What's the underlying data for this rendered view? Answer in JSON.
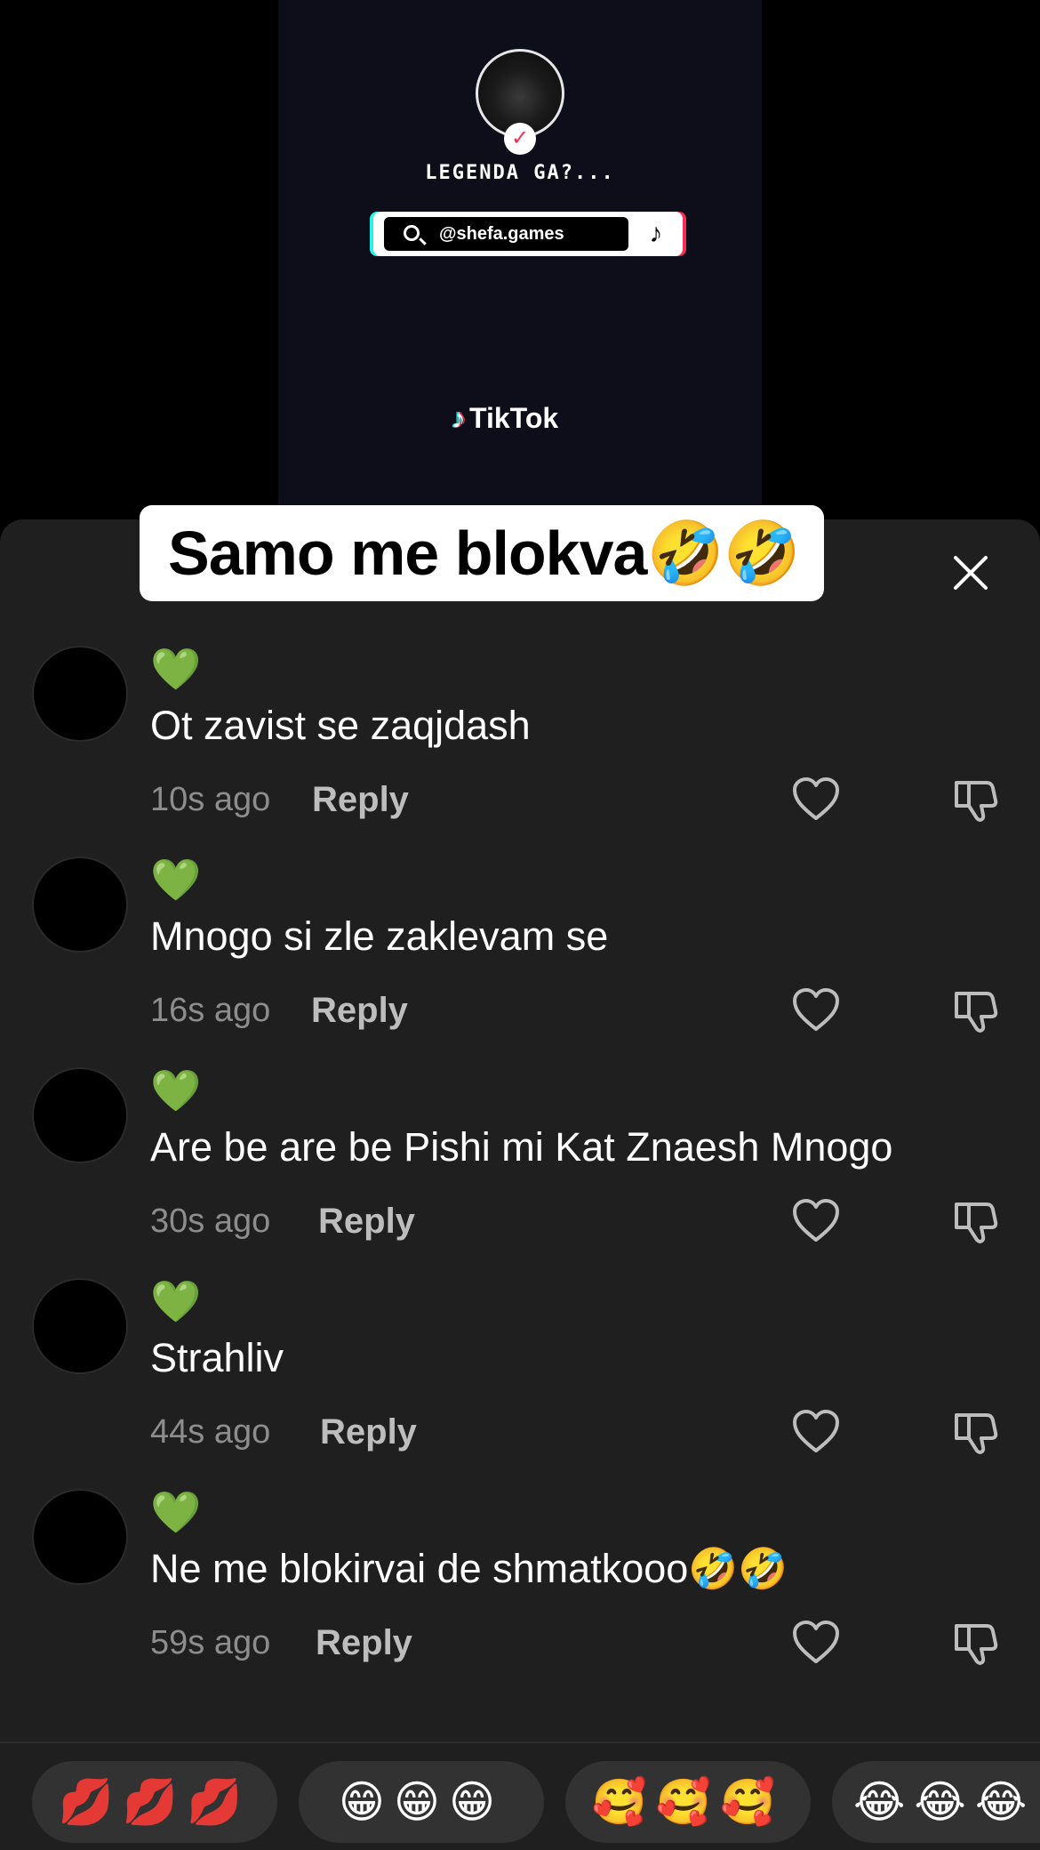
{
  "video": {
    "profile_name": "LEGENDA GA?...",
    "verified_mark": "✓",
    "search_handle": "@shefa.games",
    "tiktok_note": "♪",
    "brand": "TikTok"
  },
  "caption": "Samo me blokva🤣🤣",
  "comments": [
    {
      "heart": "💚",
      "text": "Ot zavist se zaqjdash",
      "time": "10s ago",
      "reply": "Reply"
    },
    {
      "heart": "💚",
      "text": "Mnogo si zle zaklevam se",
      "time": "16s ago",
      "reply": "Reply"
    },
    {
      "heart": "💚",
      "text": "Are be are be Pishi mi Kat Znaesh Mnogo",
      "time": "30s ago",
      "reply": "Reply"
    },
    {
      "heart": "💚",
      "text": "Strahliv",
      "time": "44s ago",
      "reply": "Reply"
    },
    {
      "heart": "💚",
      "text": "Ne me blokirvai de shmatkooo🤣🤣",
      "time": "59s ago",
      "reply": "Reply"
    }
  ],
  "reactions": [
    "💋💋💋",
    "😁😁😁",
    "🥰🥰🥰",
    "😂😂😂"
  ],
  "icons": {
    "like": "heart-outline-icon",
    "dislike": "thumbs-down-icon",
    "close": "close-icon",
    "search": "search-icon"
  }
}
